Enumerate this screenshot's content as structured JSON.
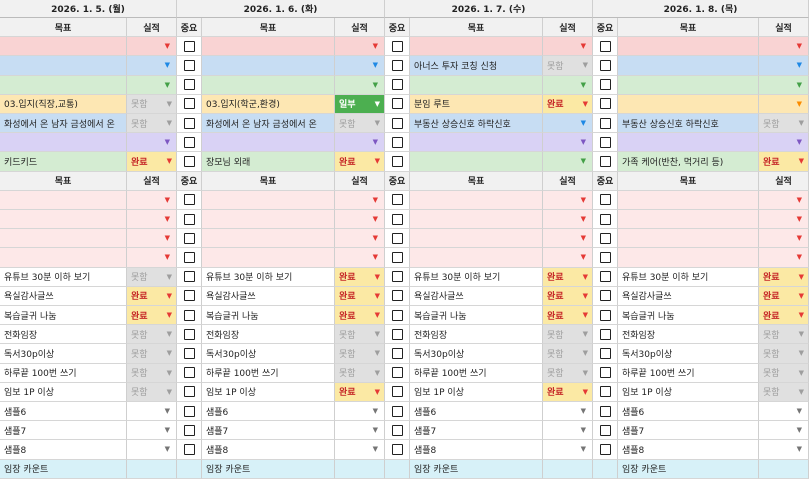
{
  "colors": {
    "red": "#f9d3d3",
    "green": "#d4ecd2",
    "yellow": "#fde7b3",
    "blue": "#c7ddf3",
    "purple": "#d9d2f5",
    "pink": "#fde8e8",
    "cyan": "#d7f1f8",
    "white": "#ffffff",
    "arrow_red": "#e53935",
    "arrow_blue": "#1e88e5",
    "arrow_green": "#43a047",
    "arrow_orange": "#fb8c00",
    "arrow_purple": "#7e57c2",
    "arrow_gray": "#757575"
  },
  "dates": [
    "2026. 1. 5. (월)",
    "2026. 1. 6. (화)",
    "2026. 1. 7. (수)",
    "2026. 1. 8. (목)"
  ],
  "headers": {
    "importance": "중요",
    "goal": "목표",
    "result": "실적"
  },
  "status_labels": {
    "done": "완료",
    "fail": "못함",
    "partial": "일부"
  },
  "rows": [
    {
      "type": "header"
    },
    {
      "bg": "red",
      "arrow": "arrow_red",
      "cells": [
        {
          "goal": "",
          "status": ""
        },
        {
          "goal": "",
          "status": ""
        },
        {
          "goal": "",
          "status": ""
        },
        {
          "goal": "",
          "status": ""
        }
      ]
    },
    {
      "bg": "blue",
      "arrow": "arrow_blue",
      "cells": [
        {
          "goal": "",
          "status": ""
        },
        {
          "goal": "",
          "status": ""
        },
        {
          "goal": "아너스 투자 코칭 신청",
          "status": "fail"
        },
        {
          "goal": "",
          "status": ""
        }
      ]
    },
    {
      "bg": "green",
      "arrow": "arrow_green",
      "cells": [
        {
          "goal": "",
          "status": ""
        },
        {
          "goal": "",
          "status": ""
        },
        {
          "goal": "",
          "status": ""
        },
        {
          "goal": "",
          "status": ""
        }
      ]
    },
    {
      "bg": "yellow",
      "arrow": "arrow_orange",
      "cells": [
        {
          "goal": "03.입지(직장,교통)",
          "status": "fail"
        },
        {
          "goal": "03.입지(학군,환경)",
          "status": "partial"
        },
        {
          "goal": "분임 루트",
          "status": "done"
        },
        {
          "goal": "",
          "status": ""
        }
      ]
    },
    {
      "bg": "blue",
      "arrow": "arrow_blue",
      "cells": [
        {
          "goal": "화성에서 온 남자 금성에서 온",
          "status": "fail"
        },
        {
          "goal": "화성에서 온 남자 금성에서 온",
          "status": "fail"
        },
        {
          "goal": "부동산 상승신호 하락신호",
          "status": ""
        },
        {
          "goal": "부동산 상승신호 하락신호",
          "status": "fail"
        }
      ]
    },
    {
      "bg": "purple",
      "arrow": "arrow_purple",
      "cells": [
        {
          "goal": "",
          "status": ""
        },
        {
          "goal": "",
          "status": ""
        },
        {
          "goal": "",
          "status": ""
        },
        {
          "goal": "",
          "status": ""
        }
      ]
    },
    {
      "bg": "green",
      "arrow": "arrow_green",
      "cells": [
        {
          "goal": "키드키드",
          "status": "done"
        },
        {
          "goal": "장모님 외래",
          "status": "done"
        },
        {
          "goal": "",
          "status": ""
        },
        {
          "goal": "가족 케어(반찬, 먹거리 등)",
          "status": "done"
        }
      ]
    },
    {
      "type": "header"
    },
    {
      "bg": "pink",
      "arrow": "arrow_red",
      "cells": [
        {
          "goal": "",
          "status": ""
        },
        {
          "goal": "",
          "status": ""
        },
        {
          "goal": "",
          "status": ""
        },
        {
          "goal": "",
          "status": ""
        }
      ]
    },
    {
      "bg": "pink",
      "arrow": "arrow_red",
      "cells": [
        {
          "goal": "",
          "status": ""
        },
        {
          "goal": "",
          "status": ""
        },
        {
          "goal": "",
          "status": ""
        },
        {
          "goal": "",
          "status": ""
        }
      ]
    },
    {
      "bg": "pink",
      "arrow": "arrow_red",
      "cells": [
        {
          "goal": "",
          "status": ""
        },
        {
          "goal": "",
          "status": ""
        },
        {
          "goal": "",
          "status": ""
        },
        {
          "goal": "",
          "status": ""
        }
      ]
    },
    {
      "bg": "pink",
      "arrow": "arrow_red",
      "cells": [
        {
          "goal": "",
          "status": ""
        },
        {
          "goal": "",
          "status": ""
        },
        {
          "goal": "",
          "status": ""
        },
        {
          "goal": "",
          "status": ""
        }
      ]
    },
    {
      "bg": "white",
      "arrow": "arrow_gray",
      "cells": [
        {
          "goal": "유튜브 30분 이하 보기",
          "status": "fail"
        },
        {
          "goal": "유튜브 30분 이하 보기",
          "status": "done"
        },
        {
          "goal": "유튜브 30분 이하 보기",
          "status": "done"
        },
        {
          "goal": "유튜브 30분 이하 보기",
          "status": "done"
        }
      ]
    },
    {
      "bg": "white",
      "arrow": "arrow_gray",
      "cells": [
        {
          "goal": "욕실감사글쓰",
          "status": "done"
        },
        {
          "goal": "욕실감사글쓰",
          "status": "done"
        },
        {
          "goal": "욕실감사글쓰",
          "status": "done"
        },
        {
          "goal": "욕실감사글쓰",
          "status": "done"
        }
      ]
    },
    {
      "bg": "white",
      "arrow": "arrow_gray",
      "cells": [
        {
          "goal": "복습글귀 나눔",
          "status": "done"
        },
        {
          "goal": "복습글귀 나눔",
          "status": "done"
        },
        {
          "goal": "복습글귀 나눔",
          "status": "done"
        },
        {
          "goal": "복습글귀 나눔",
          "status": "done"
        }
      ]
    },
    {
      "bg": "white",
      "arrow": "arrow_gray",
      "cells": [
        {
          "goal": "전화임장",
          "status": "fail"
        },
        {
          "goal": "전화임장",
          "status": "fail"
        },
        {
          "goal": "전화임장",
          "status": "fail"
        },
        {
          "goal": "전화임장",
          "status": "fail"
        }
      ]
    },
    {
      "bg": "white",
      "arrow": "arrow_gray",
      "cells": [
        {
          "goal": "독서30p이상",
          "status": "fail"
        },
        {
          "goal": "독서30p이상",
          "status": "fail"
        },
        {
          "goal": "독서30p이상",
          "status": "fail"
        },
        {
          "goal": "독서30p이상",
          "status": "fail"
        }
      ]
    },
    {
      "bg": "white",
      "arrow": "arrow_gray",
      "cells": [
        {
          "goal": "하루끝 100번 쓰기",
          "status": "fail"
        },
        {
          "goal": "하루끝 100번 쓰기",
          "status": "fail"
        },
        {
          "goal": "하루끝 100번 쓰기",
          "status": "fail"
        },
        {
          "goal": "하루끝 100번 쓰기",
          "status": "fail"
        }
      ]
    },
    {
      "bg": "white",
      "arrow": "arrow_gray",
      "cells": [
        {
          "goal": "임보 1P 이상",
          "status": "fail"
        },
        {
          "goal": "임보 1P 이상",
          "status": "done"
        },
        {
          "goal": "임보 1P 이상",
          "status": "done"
        },
        {
          "goal": "임보 1P 이상",
          "status": "fail"
        }
      ]
    },
    {
      "bg": "white",
      "arrow": "arrow_gray",
      "cells": [
        {
          "goal": "샘플6",
          "status": ""
        },
        {
          "goal": "샘플6",
          "status": ""
        },
        {
          "goal": "샘플6",
          "status": ""
        },
        {
          "goal": "샘플6",
          "status": ""
        }
      ]
    },
    {
      "bg": "white",
      "arrow": "arrow_gray",
      "cells": [
        {
          "goal": "샘플7",
          "status": ""
        },
        {
          "goal": "샘플7",
          "status": ""
        },
        {
          "goal": "샘플7",
          "status": ""
        },
        {
          "goal": "샘플7",
          "status": ""
        }
      ]
    },
    {
      "bg": "white",
      "arrow": "arrow_gray",
      "cells": [
        {
          "goal": "샘플8",
          "status": ""
        },
        {
          "goal": "샘플8",
          "status": ""
        },
        {
          "goal": "샘플8",
          "status": ""
        },
        {
          "goal": "샘플8",
          "status": ""
        }
      ]
    },
    {
      "type": "footer",
      "bg": "cyan",
      "label": "임장 카운트"
    }
  ],
  "icons": {
    "checkbox": "checkbox-icon",
    "dropdown": "chevron-down-icon"
  }
}
